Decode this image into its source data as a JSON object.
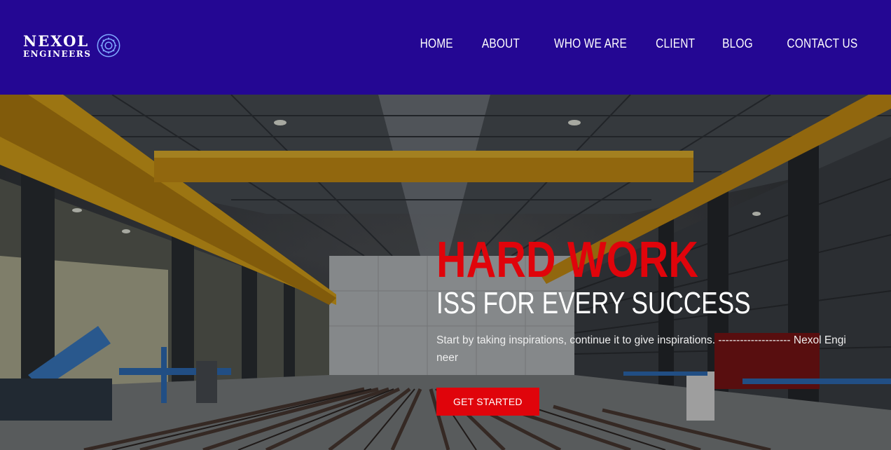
{
  "brand": {
    "name": "NEXOL",
    "subtitle": "ENGINEERS",
    "icon": "gear-icon"
  },
  "nav": {
    "items": [
      {
        "label": "HOME"
      },
      {
        "label": "ABOUT"
      },
      {
        "label": "WHO WE ARE"
      },
      {
        "label": "CLIENT"
      },
      {
        "label": "BLOG"
      },
      {
        "label": "CONTACT US"
      }
    ]
  },
  "hero": {
    "title": "HARD WORK",
    "subtitle": "ISS FOR EVERY SUCCESS",
    "text": "Start by taking inspirations, continue it to give inspirations. -------------------- Nexol Engineer",
    "button_label": "GET STARTED",
    "background_image": "industrial-warehouse-photo"
  },
  "colors": {
    "header_bg": "#240793",
    "accent_red": "#e0040b",
    "text_white": "#ffffff"
  }
}
